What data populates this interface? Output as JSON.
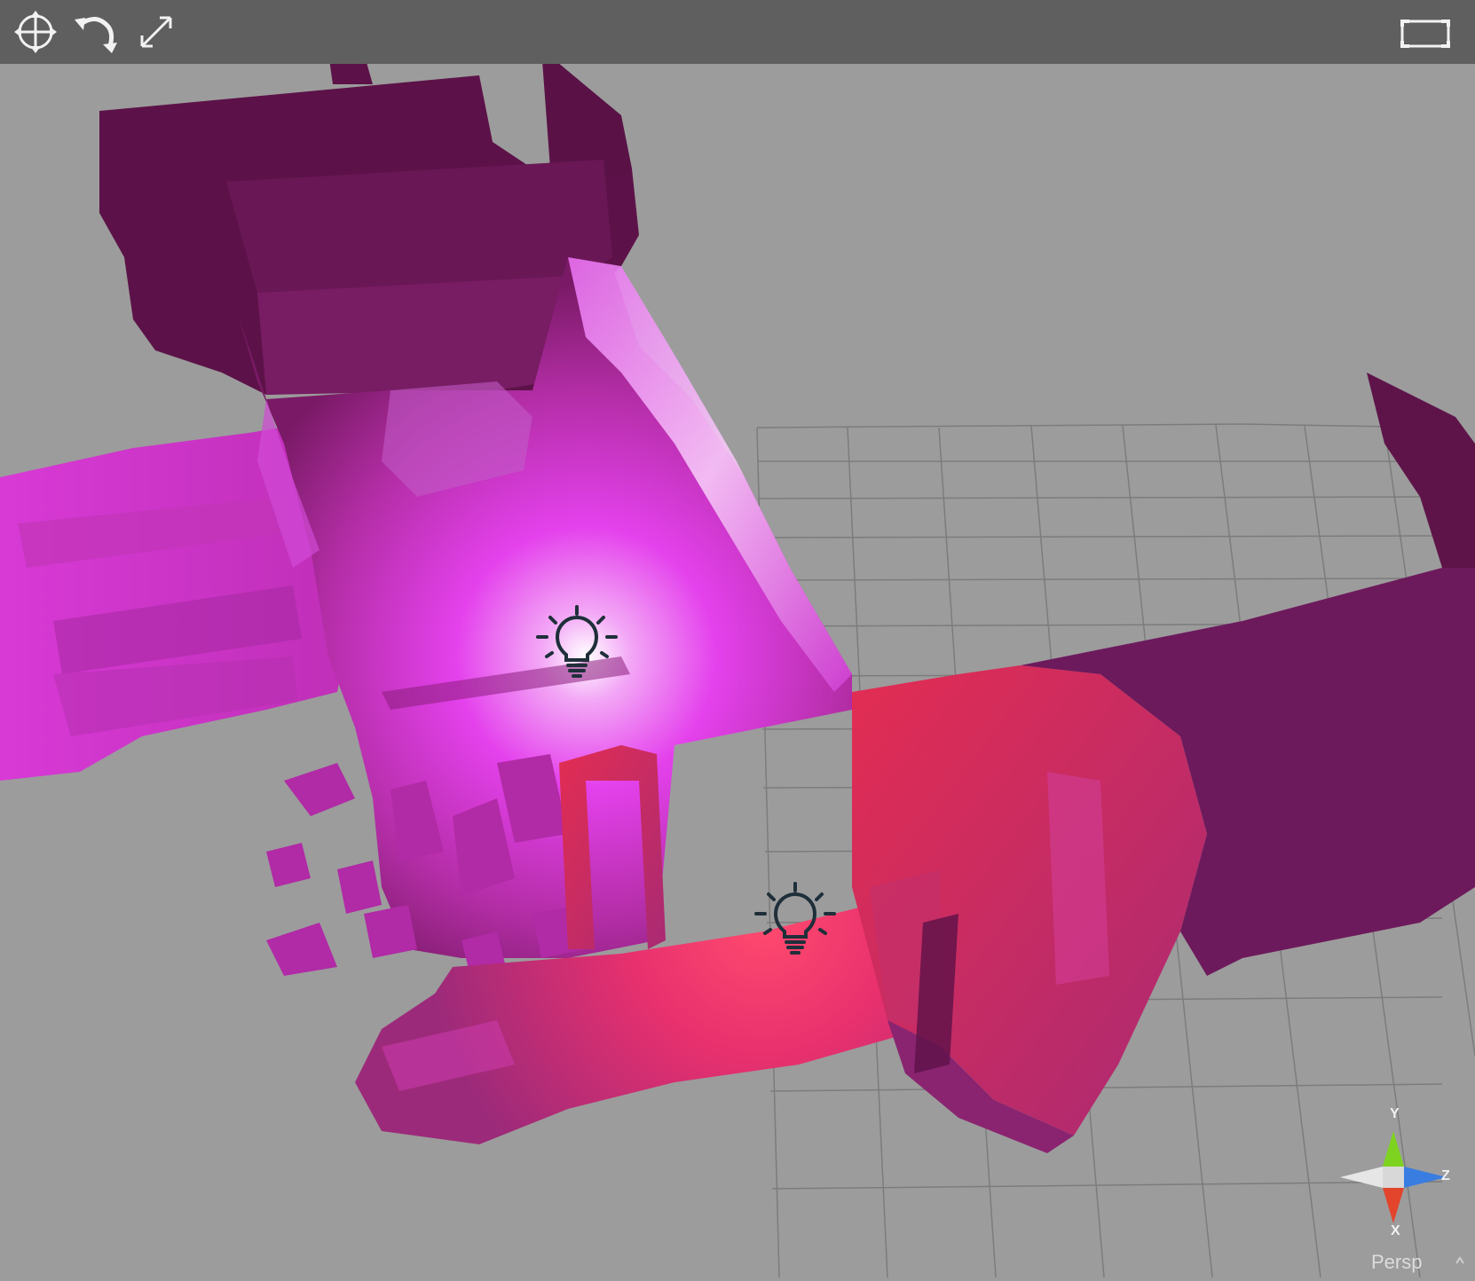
{
  "viewport": {
    "projection_label": "Persp",
    "background_color": "#9c9c9c",
    "toolbar_color": "#5f5f5f"
  },
  "toolbar": {
    "left_tools": [
      {
        "name": "move-tool",
        "icon": "move-arrows-icon"
      },
      {
        "name": "rotate-tool",
        "icon": "rotate-arrow-icon"
      },
      {
        "name": "scale-tool",
        "icon": "diagonal-expand-icon"
      }
    ],
    "right_tools": [
      {
        "name": "maximize-view",
        "icon": "maximize-frame-icon"
      }
    ]
  },
  "axis_gizmo": {
    "y_label": "Y",
    "x_label": "X",
    "z_label": "Z",
    "y_color": "#7ed321",
    "x_color": "#e2452c",
    "z_color": "#3a7de0"
  },
  "scene": {
    "objects": [
      {
        "type": "point-light",
        "icon": "lightbulb-icon"
      },
      {
        "type": "point-light",
        "icon": "lightbulb-icon"
      }
    ],
    "mesh_colors": {
      "dark": "#5c1248",
      "mid": "#b02a9a",
      "bright": "#e63fe8",
      "hot": "#f0336c"
    }
  }
}
